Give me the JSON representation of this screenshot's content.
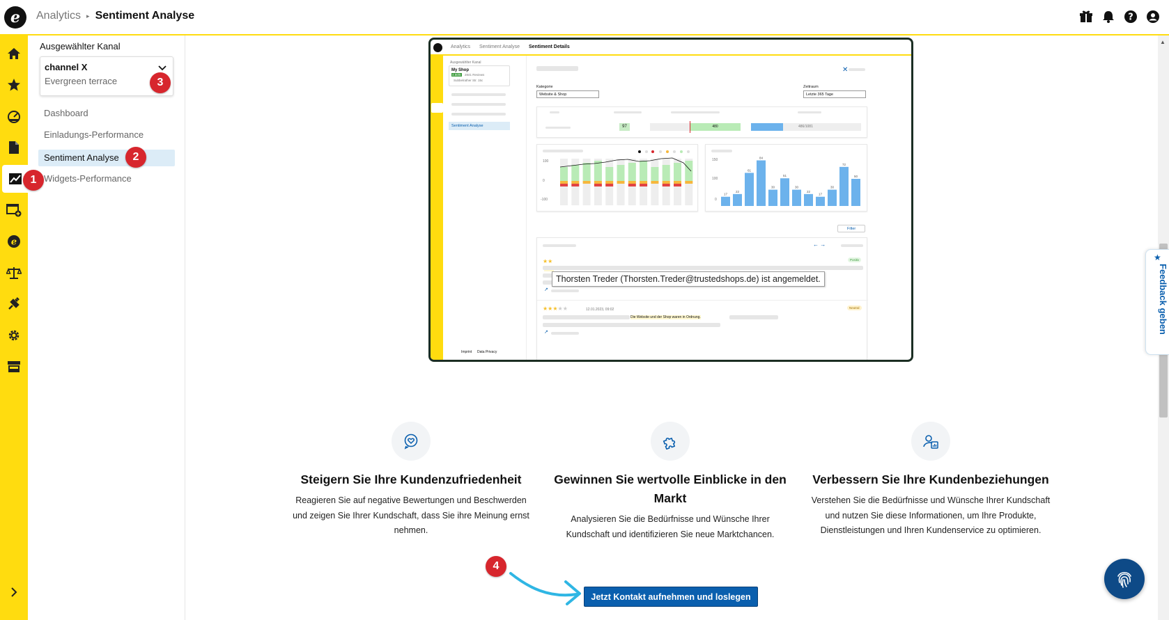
{
  "header": {
    "breadcrumb_root": "Analytics",
    "breadcrumb_current": "Sentiment Analyse",
    "icons": [
      "gift-icon",
      "bell-icon",
      "help-icon",
      "account-icon"
    ]
  },
  "rail": {
    "icons": [
      "home-icon",
      "star-icon",
      "dashboard-gauge-icon",
      "document-icon",
      "analytics-chart-icon",
      "browser-add-icon",
      "trusted-logo-icon",
      "scales-icon",
      "plugin-icon",
      "settings-gear-icon",
      "shop-icon",
      "chevron-right-icon"
    ]
  },
  "sidebar": {
    "channel_label": "Ausgewählter Kanal",
    "channel_name": "channel X",
    "channel_sub": "Evergreen terrace",
    "items": [
      {
        "label": "Dashboard"
      },
      {
        "label": "Einladungs-Performance"
      },
      {
        "label": "Sentiment Analyse"
      },
      {
        "label": "Widgets-Performance"
      }
    ]
  },
  "badges": {
    "b1": "1",
    "b2": "2",
    "b3": "3",
    "b4": "4"
  },
  "preview": {
    "crumb1": "Analytics",
    "crumb2": "Sentiment Analyse",
    "crumb3": "Sentiment Details",
    "side_label": "Ausgewählter Kanal",
    "shop_name": "My Shop",
    "shop_rating": "4.50/5",
    "shop_reviews": "2841 Reviews",
    "shop_address": "Subbelrather Str. 15c",
    "side_active": "Sentiment Analyse",
    "imprint": "Imprint",
    "privacy": "Data Privacy",
    "kategorie_label": "Kategorie",
    "kategorie_value": "Website & Shop",
    "zeitraum_label": "Zeitraum",
    "zeitraum_value": "Letzte 365 Tage",
    "score": "97",
    "green_bar": "480",
    "blue_bar": "486/1081",
    "chart1_ticks": [
      "100",
      "0",
      "-100"
    ],
    "chart2_ticks": [
      "150",
      "100",
      "0"
    ],
    "chart2_values": [
      17,
      22,
      61,
      84,
      30,
      51,
      30,
      22,
      17,
      30,
      72,
      50
    ],
    "filter": "Filter",
    "review1_badge": "Positiv",
    "review1_text": "Ich ha",
    "review2_date": "12.01.2023, 09:02",
    "review2_badge": "Neutral",
    "review2_text": "Die Website und der Shop waren in Ordnung."
  },
  "tooltip": "Thorsten Treder (Thorsten.Treder@trustedshops.de) ist angemeldet.",
  "features": [
    {
      "icon": "heart-chat-icon",
      "title": "Steigern Sie Ihre Kundenzufriedenheit",
      "text": "Reagieren Sie auf negative Bewertungen und Beschwerden und zeigen Sie Ihrer Kundschaft, dass Sie ihre Meinung ernst nehmen."
    },
    {
      "icon": "puzzle-icon",
      "title": "Gewinnen Sie wertvolle Einblicke in den Markt",
      "text": "Analysieren Sie die Bedürfnisse und Wünsche Ihrer Kundschaft und identifizieren Sie neue Marktchancen."
    },
    {
      "icon": "user-chart-icon",
      "title": "Verbessern Sie Ihre Kundenbeziehungen",
      "text": "Verstehen Sie die Bedürfnisse und Wünsche Ihrer Kundschaft und nutzen Sie diese Informationen, um Ihre Produkte, Dienstleistungen und Ihren Kundenservice zu optimieren."
    }
  ],
  "cta": "Jetzt Kontakt aufnehmen und loslegen",
  "feedback": "Feedback geben",
  "colors": {
    "brand_yellow": "#ffdc0f",
    "primary_blue": "#0a5fae",
    "badge_red": "#d7262d"
  }
}
